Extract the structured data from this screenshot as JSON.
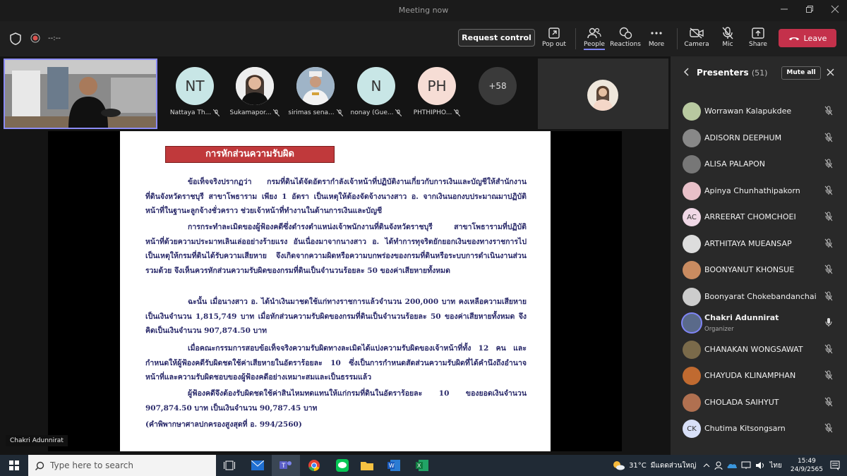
{
  "window": {
    "title": "Meeting now"
  },
  "toolbar": {
    "timer": "--:--",
    "request_control": "Request control",
    "pop_out": "Pop out",
    "people": "People",
    "reactions": "Reactions",
    "more": "More",
    "camera": "Camera",
    "mic": "Mic",
    "share": "Share",
    "leave": "Leave"
  },
  "participants_strip": [
    {
      "initials": "NT",
      "name": "Nattaya Th...",
      "color": "#c8e6e6"
    },
    {
      "initials": "",
      "name": "Sukamapor...",
      "color": "#e9e9e9"
    },
    {
      "initials": "",
      "name": "sirimas sena...",
      "color": "#d9d9d9"
    },
    {
      "initials": "N",
      "name": "nonay (Gue...",
      "color": "#c8e6e6"
    },
    {
      "initials": "PH",
      "name": "PHTHIPHO...",
      "color": "#f6ddd5"
    }
  ],
  "more_count": "+58",
  "slide": {
    "heading": "การหักส่วนความรับผิด",
    "paragraphs": [
      "ข้อเท็จจริงปรากฏว่า กรมที่ดินได้จัดอัตรากำลังเจ้าหน้าที่ปฏิบัติงานเกี่ยวกับการเงินและบัญชีให้สำนักงานที่ดินจังหวัดราชบุรี สาขาโพธาราม เพียง 1 อัตรา เป็นเหตุให้ต้องจัดจ้างนางสาว อ. จากเงินนอกงบประมาณมาปฏิบัติหน้าที่ในฐานะลูกจ้างชั่วคราว ช่วยเจ้าหน้าที่ทำงานในด้านการเงินและบัญชี",
      "การกระทำละเมิดของผู้ฟ้องคดีซึ่งดำรงตำแหน่งเจ้าพนักงานที่ดินจังหวัดราชบุรี สาขาโพธารามที่ปฏิบัติหน้าที่ด้วยความประมาทเลินเล่ออย่างร้ายแรง อันเนื่องมาจากนางสาว อ. ได้ทำการทุจริตยักยอกเงินของทางราชการไป เป็นเหตุให้กรมที่ดินได้รับความเสียหาย จึงเกิดจากความผิดหรือความบกพร่องของกรมที่ดินหรือระบบการดำเนินงานส่วนรวมด้วย จึงเห็นควรหักส่วนความรับผิดของกรมที่ดินเป็นจำนวนร้อยละ 50 ของค่าเสียหายทั้งหมด",
      "ฉะนั้น เมื่อนางสาว อ. ได้นำเงินมาชดใช้แก่ทางราชการแล้วจำนวน 200,000 บาท คงเหลือความเสียหายเป็นเงินจำนวน 1,815,749 บาท เมื่อหักส่วนความรับผิดของกรมที่ดินเป็นจำนวนร้อยละ 50 ของค่าเสียหายทั้งหมด จึงคิดเป็นเงินจำนวน 907,874.50 บาท",
      "เมื่อคณะกรรมการสอบข้อเท็จจริงความรับผิดทางละเมิดได้แบ่งความรับผิดของเจ้าหน้าที่ทั้ง 12 คน และกำหนดให้ผู้ฟ้องคดีรับผิดชดใช้ค่าเสียหายในอัตราร้อยละ 10 ซึ่งเป็นการกำหนดสัดส่วนความรับผิดที่ได้คำนึงถึงอำนาจหน้าที่และความรับผิดชอบของผู้ฟ้องคดีอย่างเหมาะสมและเป็นธรรมแล้ว",
      "ผู้ฟ้องคดีจึงต้องรับผิดชดใช้ค่าสินไหมทดแทนให้แก่กรมที่ดินในอัตราร้อยละ 10 ของยอดเงินจำนวน 907,874.50 บาท เป็นเงินจำนวน 90,787.45 บาท"
    ],
    "reference": "(คำพิพากษาศาลปกครองสูงสุดที่ อ. 994/2560)"
  },
  "speaker_name": "Chakri Adunnirat",
  "presenters": {
    "title": "Presenters",
    "count": "(51)",
    "mute_all": "Mute all",
    "items": [
      {
        "name": "Worrawan Kalapukdee",
        "initials": "",
        "color": "#b8c9a0"
      },
      {
        "name": "ADISORN DEEPHUM",
        "initials": "",
        "color": "#888888"
      },
      {
        "name": "ALISA PALAPON",
        "initials": "",
        "color": "#777777"
      },
      {
        "name": "Apinya Chunhathipakorn",
        "initials": "",
        "color": "#e8c0c8"
      },
      {
        "name": "ARREERAT CHOMCHOEI",
        "initials": "AC",
        "color": "#f0d8e6"
      },
      {
        "name": "ARTHITAYA MUEANSAP",
        "initials": "",
        "color": "#dddddd"
      },
      {
        "name": "BOONYANUT KHONSUE",
        "initials": "",
        "color": "#c98b60"
      },
      {
        "name": "Boonyarat Chokebandanchai",
        "initials": "",
        "color": "#cccccc"
      },
      {
        "name": "Chakri Adunnirat",
        "initials": "",
        "color": "#5a6a8a",
        "sub": "Organizer",
        "active": true
      },
      {
        "name": "CHANAKAN WONGSAWAT",
        "initials": "",
        "color": "#7a6a4a"
      },
      {
        "name": "CHAYUDA KLINAMPHAN",
        "initials": "",
        "color": "#c06a30"
      },
      {
        "name": "CHOLADA SAIHYUT",
        "initials": "",
        "color": "#b07050"
      },
      {
        "name": "Chutima Kitsongsarn",
        "initials": "CK",
        "color": "#d8e0f8"
      }
    ]
  },
  "taskbar": {
    "search_placeholder": "Type here to search",
    "temperature": "31°C",
    "weather": "มีแดดส่วนใหญ่",
    "lang": "ไทย",
    "time": "15:49",
    "date": "24/9/2565"
  }
}
